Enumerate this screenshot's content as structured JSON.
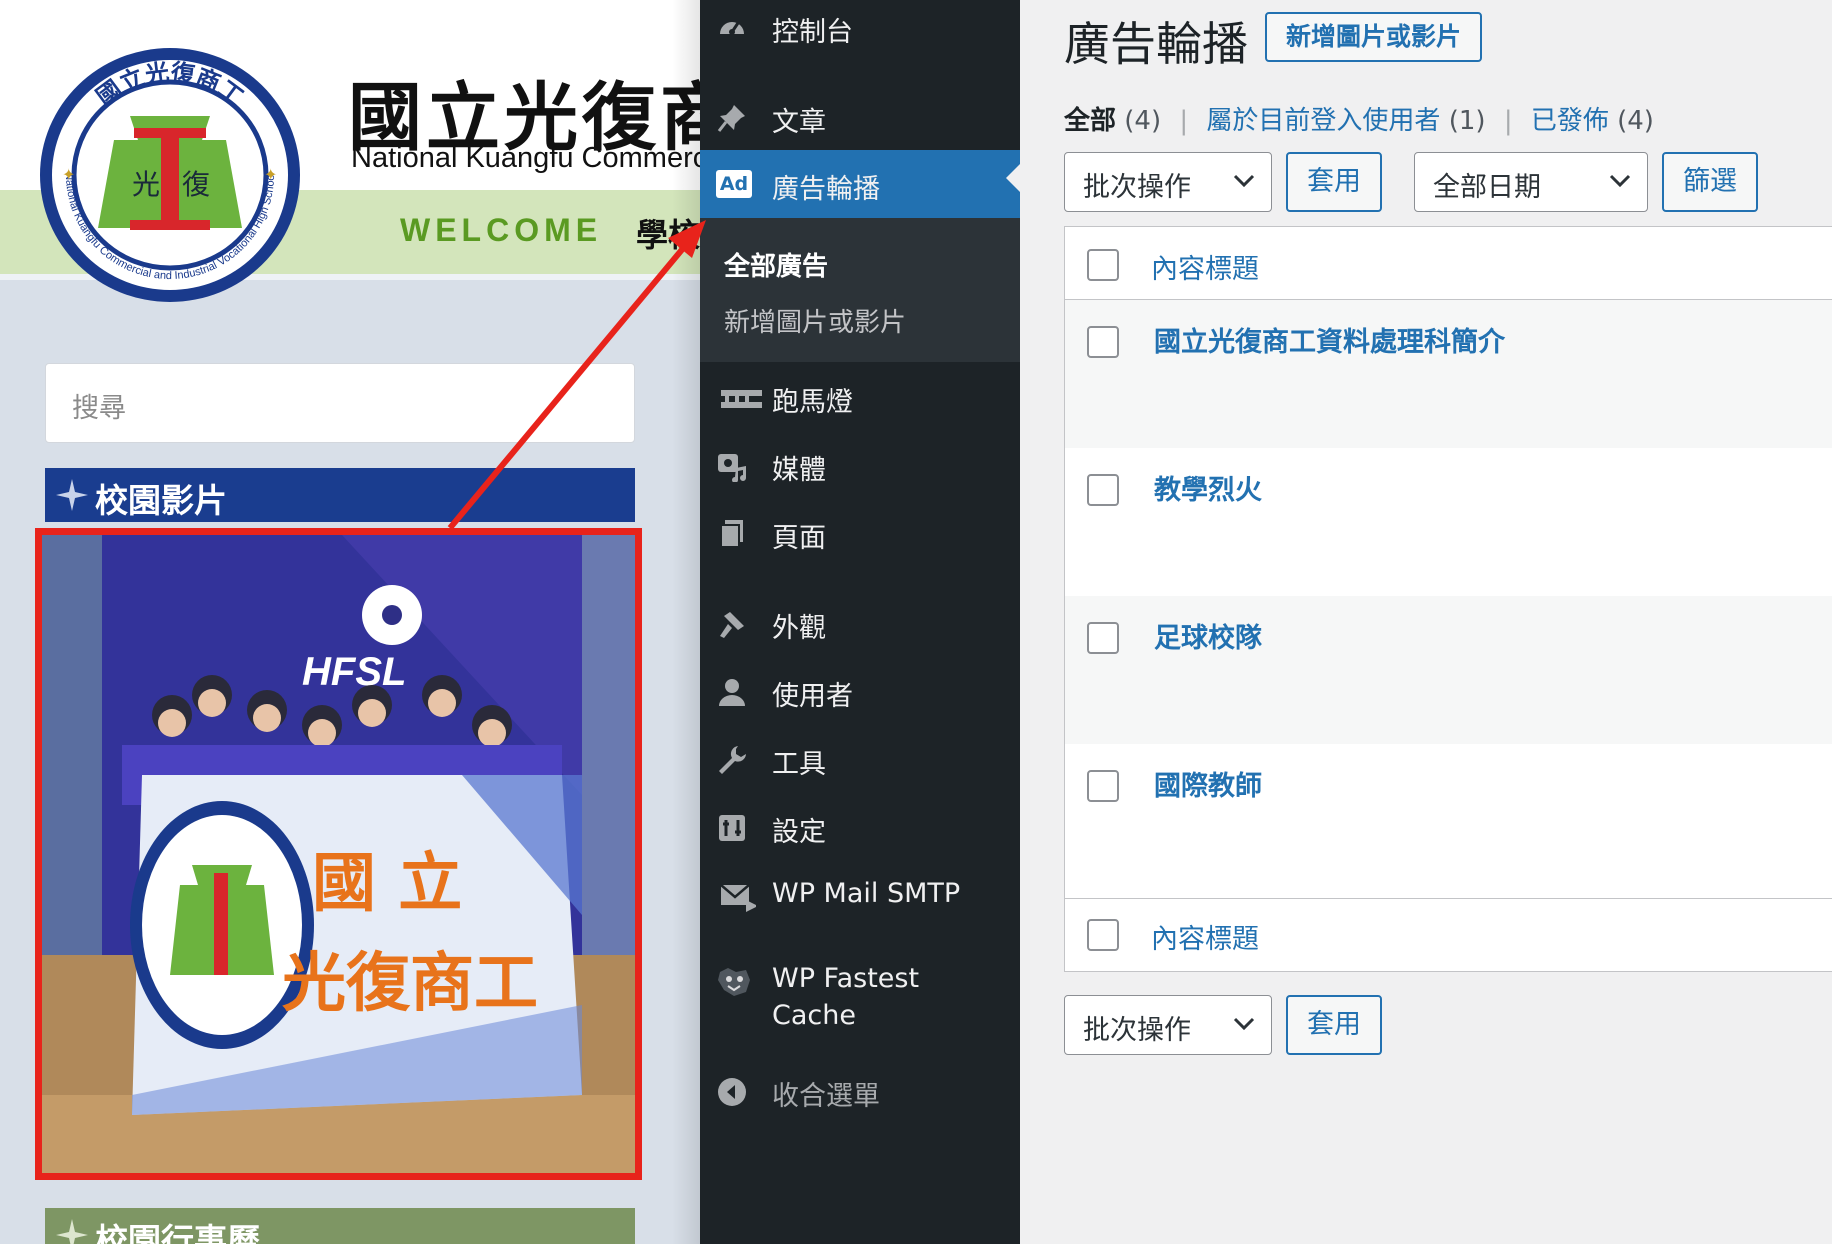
{
  "site": {
    "title_cn": "國立光復商",
    "title_en": "National Kuangfu Commercia",
    "seal": {
      "ring_text_cn": "國立光復商工",
      "ring_text_en": "National Kuangfu Commercial and Industrial Vocational High School",
      "center_left": "光",
      "center_right": "復"
    },
    "nav": {
      "welcome": "WELCOME",
      "cut_item": "學校"
    },
    "search": {
      "placeholder": "搜尋"
    },
    "widgets": [
      {
        "title": "校園影片"
      },
      {
        "title": "校園行事曆"
      }
    ],
    "photo": {
      "banner_logo": "HFSL",
      "banner_text_line1": "國  立",
      "banner_text_line2": "光復商工"
    }
  },
  "admin_menu": {
    "items": [
      {
        "label": "控制台",
        "icon": "dashboard-icon"
      },
      {
        "label": "文章",
        "icon": "pin-icon"
      },
      {
        "label": "廣告輪播",
        "icon": "ad-icon",
        "badge": "Ad",
        "active": true
      },
      {
        "label": "跑馬燈",
        "icon": "marquee-icon"
      },
      {
        "label": "媒體",
        "icon": "media-icon"
      },
      {
        "label": "頁面",
        "icon": "page-icon"
      },
      {
        "label": "外觀",
        "icon": "appearance-icon"
      },
      {
        "label": "使用者",
        "icon": "user-icon"
      },
      {
        "label": "工具",
        "icon": "wrench-icon"
      },
      {
        "label": "設定",
        "icon": "settings-icon"
      },
      {
        "label": "WP Mail SMTP",
        "icon": "mail-icon"
      },
      {
        "label_line1": "WP Fastest",
        "label_line2": "Cache",
        "icon": "cheetah-icon"
      },
      {
        "label": "收合選單",
        "icon": "collapse-icon"
      }
    ],
    "submenu": {
      "current": "全部廣告",
      "other": "新增圖片或影片"
    }
  },
  "main": {
    "heading": "廣告輪播",
    "add_new": "新增圖片或影片",
    "filters": {
      "all": "全部",
      "all_count": "(4)",
      "mine": "屬於目前登入使用者",
      "mine_count": "(1)",
      "published": "已發佈",
      "published_count": "(4)"
    },
    "bulk_action": "批次操作",
    "apply": "套用",
    "all_dates": "全部日期",
    "filter": "篩選",
    "column_title": "內容標題",
    "rows": [
      {
        "title": "國立光復商工資料處理科簡介"
      },
      {
        "title": "教學烈火"
      },
      {
        "title": "足球校隊"
      },
      {
        "title": "國際教師"
      }
    ],
    "column_title_footer": "內容標題",
    "bulk_action_bottom": "批次操作",
    "apply_bottom": "套用"
  },
  "annotation_color": "#e8231b",
  "accent_color": "#2271b1"
}
